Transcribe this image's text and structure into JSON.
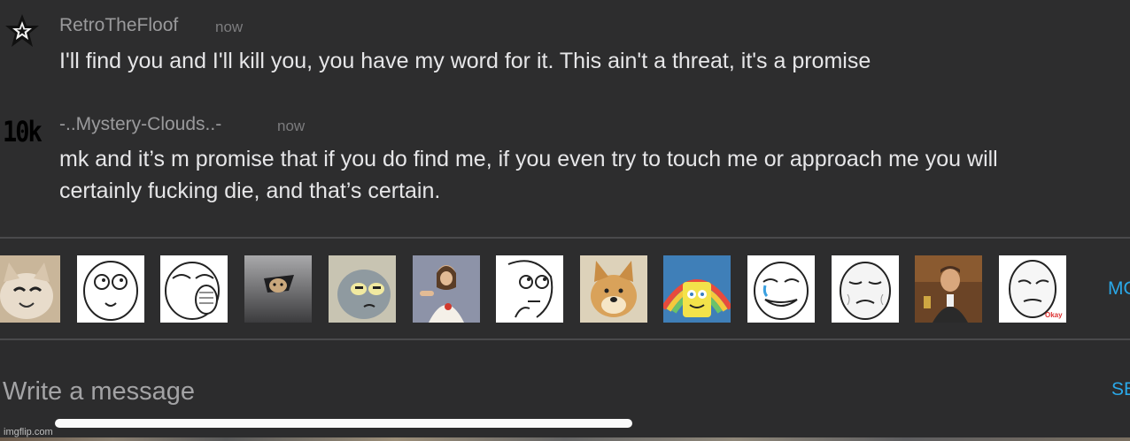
{
  "messages": [
    {
      "username": "RetroTheFloof",
      "timestamp": "now",
      "avatar": "star-icon",
      "lines": [
        "I'll find you and I'll kill you, you have my word for it. This ain't a threat, it's a promise"
      ]
    },
    {
      "username": "-..Mystery-Clouds..-",
      "timestamp": "now",
      "avatar_text": "10k",
      "lines": [
        "mk and it’s m promise that if you do find me, if you even try to touch me or approach me you will",
        "certainly fucking die, and that’s certain."
      ]
    }
  ],
  "meme_strip": {
    "items": [
      "smiling-cat-meme",
      "derp-face-meme",
      "lol-face-meme",
      "ceiling-cat-meme",
      "unsettled-tom-meme",
      "buddy-christ-meme",
      "thinking-face-meme",
      "doge-meme",
      "imagination-spongebob-meme",
      "happy-tears-face-meme",
      "okay-guy-meme",
      "laughing-leo-meme",
      "okay-face-meme"
    ],
    "more_label": "MO"
  },
  "compose": {
    "placeholder": "Write a message",
    "send_label": "SE"
  },
  "watermark": "imgflip.com",
  "colors": {
    "background": "#2d2d2e",
    "accent": "#2aa8e8",
    "text": "#e6e6e8",
    "muted": "#9a9a9c"
  }
}
